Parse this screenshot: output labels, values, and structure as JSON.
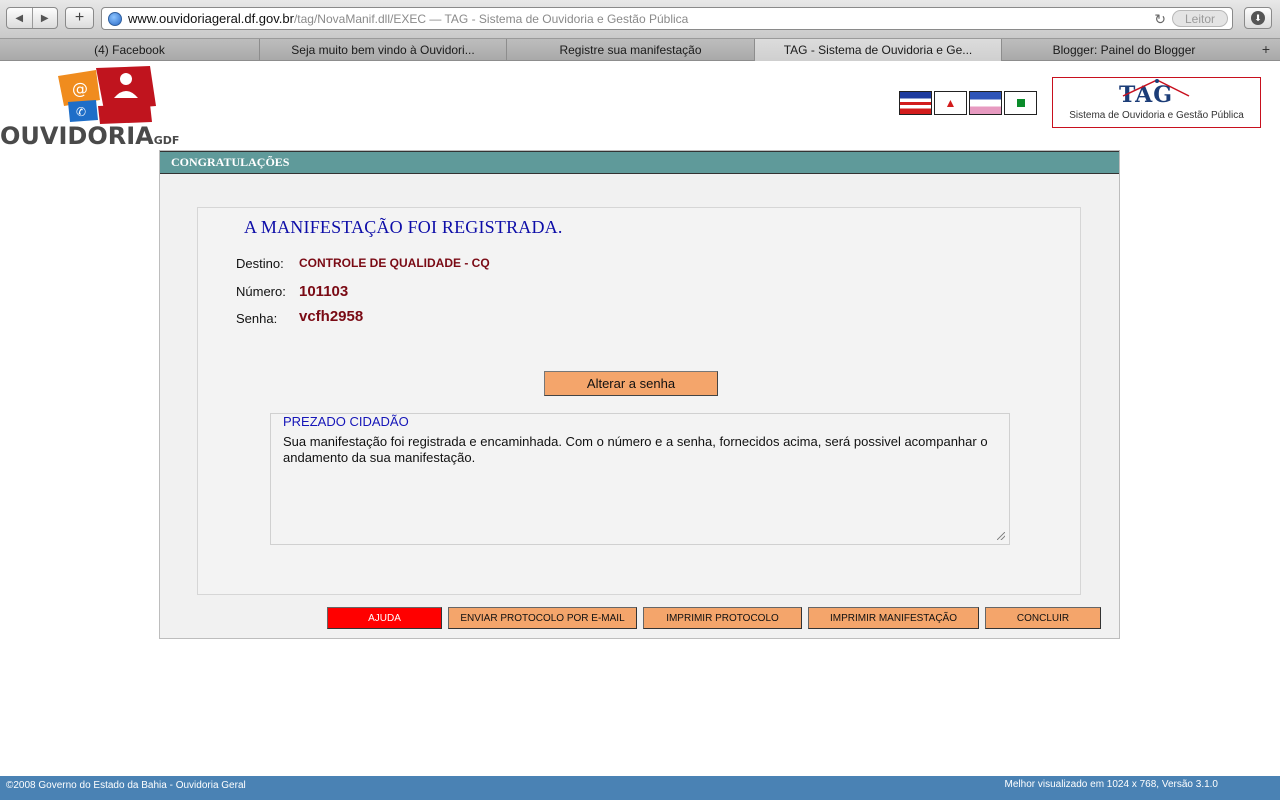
{
  "browser": {
    "url_host": "www.ouvidoriageral.df.gov.br",
    "url_rest": "/tag/NovaManif.dll/EXEC — TAG - Sistema de Ouvidoria e Gestão Pública",
    "reader_label": "Leitor",
    "tabs": [
      {
        "label": "(4) Facebook"
      },
      {
        "label": "Seja muito bem vindo à Ouvidori..."
      },
      {
        "label": "Registre sua manifestação"
      },
      {
        "label": "TAG - Sistema de Ouvidoria e Ge..."
      },
      {
        "label": "Blogger: Painel do Blogger"
      }
    ]
  },
  "header": {
    "logo_text": "OUVIDORIA",
    "logo_suffix": "GDF",
    "tag_logo": "TAG",
    "tag_caption": "Sistema de Ouvidoria e Gestão Pública"
  },
  "panel": {
    "title": "CONGRATULAÇÕES",
    "heading": "A MANIFESTAÇÃO FOI REGISTRADA.",
    "destino_label": "Destino:",
    "destino_value": "CONTROLE DE QUALIDADE - CQ",
    "numero_label": "Número:",
    "numero_value": "101103",
    "senha_label": "Senha:",
    "senha_value": "vcfh2958",
    "alterar_label": "Alterar a senha",
    "legend": "PREZADO CIDADÃO",
    "message": "Sua manifestação foi registrada e encaminhada. Com o número e a senha, fornecidos acima, será possivel acompanhar o andamento da sua manifestação."
  },
  "actions": {
    "ajuda": "AJUDA",
    "enviar": "ENVIAR PROTOCOLO POR E-MAIL",
    "imprimir_protocolo": "IMPRIMIR PROTOCOLO",
    "imprimir_manifestacao": "IMPRIMIR MANIFESTAÇÃO",
    "concluir": "CONCLUIR"
  },
  "footer": {
    "left": "©2008 Governo do Estado da Bahia - Ouvidoria Geral",
    "right": "Melhor visualizado em 1024 x 768, Versão 3.1.0"
  },
  "colors": {
    "panel_header": "#5f9a9a",
    "button_orange": "#f4a56b",
    "button_help": "#ff0000",
    "footer": "#4a82b4",
    "value_text": "#7a0a14",
    "heading_text": "#0d0da8"
  }
}
